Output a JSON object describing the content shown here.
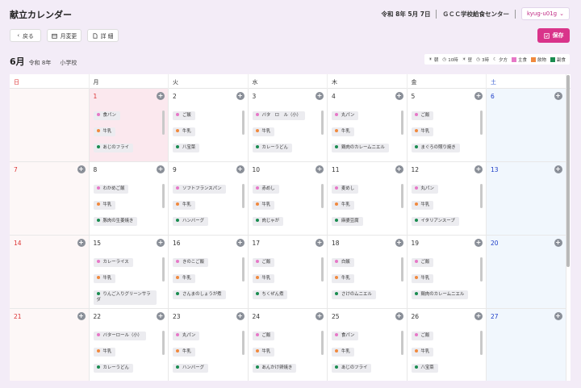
{
  "header": {
    "title": "献立カレンダー",
    "date": "令和 8年 5月 7日",
    "center": "ＧＣＣ学校給食センター",
    "user": "kyug-u01g"
  },
  "toolbar": {
    "back_label": "戻る",
    "month_change_label": "月変更",
    "detail_label": "詳 細",
    "save_label": "保存"
  },
  "month": {
    "title": "6月",
    "era": "令和 8年",
    "school": "小学校"
  },
  "legend": {
    "items": [
      {
        "label": "朝"
      },
      {
        "label": "10時"
      },
      {
        "label": "昼"
      },
      {
        "label": "3時"
      },
      {
        "label": "夕方"
      }
    ],
    "categories": [
      {
        "label": "主食",
        "color": "#e678c7"
      },
      {
        "label": "飲物",
        "color": "#f0893e"
      },
      {
        "label": "副食",
        "color": "#1a8c50"
      }
    ]
  },
  "weekdays": [
    "日",
    "月",
    "火",
    "水",
    "木",
    "金",
    "土"
  ],
  "weeks": [
    [
      {
        "day": "",
        "type": "sun",
        "items": []
      },
      {
        "day": "1",
        "type": "today",
        "items": [
          [
            "食パン",
            "main"
          ],
          [
            "牛乳",
            "milk"
          ],
          [
            "あじのフライ",
            "side"
          ]
        ]
      },
      {
        "day": "2",
        "type": "",
        "items": [
          [
            "ご飯",
            "main"
          ],
          [
            "牛乳",
            "milk"
          ],
          [
            "八宝菜",
            "side"
          ]
        ]
      },
      {
        "day": "3",
        "type": "",
        "items": [
          [
            "バタ　ロ　ル（小）",
            "main"
          ],
          [
            "牛乳",
            "milk"
          ],
          [
            "カレーうどん",
            "side"
          ]
        ]
      },
      {
        "day": "4",
        "type": "",
        "items": [
          [
            "丸パン",
            "main"
          ],
          [
            "牛乳",
            "milk"
          ],
          [
            "鶏肉のカレームニエル",
            "side"
          ]
        ]
      },
      {
        "day": "5",
        "type": "",
        "items": [
          [
            "ご飯",
            "main"
          ],
          [
            "牛乳",
            "milk"
          ],
          [
            "まぐろの照り焼き",
            "side"
          ]
        ]
      },
      {
        "day": "6",
        "type": "sat",
        "items": []
      }
    ],
    [
      {
        "day": "7",
        "type": "sun",
        "items": []
      },
      {
        "day": "8",
        "type": "",
        "items": [
          [
            "わかめご飯",
            "main"
          ],
          [
            "牛乳",
            "milk"
          ],
          [
            "豚肉の生姜焼き",
            "side"
          ]
        ]
      },
      {
        "day": "9",
        "type": "",
        "items": [
          [
            "ソフトフランスパン",
            "main"
          ],
          [
            "牛乳",
            "milk"
          ],
          [
            "ハンバーグ",
            "side"
          ]
        ]
      },
      {
        "day": "10",
        "type": "",
        "items": [
          [
            "赤めし",
            "main"
          ],
          [
            "牛乳",
            "milk"
          ],
          [
            "肉じゃが",
            "side"
          ]
        ]
      },
      {
        "day": "11",
        "type": "",
        "items": [
          [
            "麦めし",
            "main"
          ],
          [
            "牛乳",
            "milk"
          ],
          [
            "麻婆豆腐",
            "side"
          ]
        ]
      },
      {
        "day": "12",
        "type": "",
        "items": [
          [
            "丸パン",
            "main"
          ],
          [
            "牛乳",
            "milk"
          ],
          [
            "イタリアンスープ",
            "side"
          ]
        ]
      },
      {
        "day": "13",
        "type": "sat",
        "items": []
      }
    ],
    [
      {
        "day": "14",
        "type": "sun",
        "items": []
      },
      {
        "day": "15",
        "type": "",
        "items": [
          [
            "カレーライス",
            "main"
          ],
          [
            "牛乳",
            "milk"
          ],
          [
            "りんご入りグリーンサラダ",
            "side"
          ]
        ]
      },
      {
        "day": "16",
        "type": "",
        "items": [
          [
            "きのこご飯",
            "main"
          ],
          [
            "牛乳",
            "milk"
          ],
          [
            "さんまのしょうが煮",
            "side"
          ]
        ]
      },
      {
        "day": "17",
        "type": "",
        "items": [
          [
            "ご飯",
            "main"
          ],
          [
            "牛乳",
            "milk"
          ],
          [
            "ちくぜん煮",
            "side"
          ]
        ]
      },
      {
        "day": "18",
        "type": "",
        "items": [
          [
            "白飯",
            "main"
          ],
          [
            "牛乳",
            "milk"
          ],
          [
            "さけのムニエル",
            "side"
          ]
        ]
      },
      {
        "day": "19",
        "type": "",
        "items": [
          [
            "ご飯",
            "main"
          ],
          [
            "牛乳",
            "milk"
          ],
          [
            "鶏肉のカレームニエル",
            "side"
          ]
        ]
      },
      {
        "day": "20",
        "type": "sat",
        "items": []
      }
    ],
    [
      {
        "day": "21",
        "type": "sun",
        "items": []
      },
      {
        "day": "22",
        "type": "",
        "items": [
          [
            "バターロール（小）",
            "main"
          ],
          [
            "牛乳",
            "milk"
          ],
          [
            "カレーうどん",
            "side"
          ]
        ]
      },
      {
        "day": "23",
        "type": "",
        "items": [
          [
            "丸パン",
            "main"
          ],
          [
            "牛乳",
            "milk"
          ],
          [
            "ハンバーグ",
            "side"
          ]
        ]
      },
      {
        "day": "24",
        "type": "",
        "items": [
          [
            "ご飯",
            "main"
          ],
          [
            "牛乳",
            "milk"
          ],
          [
            "あんかけ卵焼き",
            "side"
          ]
        ]
      },
      {
        "day": "25",
        "type": "",
        "items": [
          [
            "食パン",
            "main"
          ],
          [
            "牛乳",
            "milk"
          ],
          [
            "あじのフライ",
            "side"
          ]
        ]
      },
      {
        "day": "26",
        "type": "",
        "items": [
          [
            "ご飯",
            "main"
          ],
          [
            "牛乳",
            "milk"
          ],
          [
            "八宝菜",
            "side"
          ]
        ]
      },
      {
        "day": "27",
        "type": "sat",
        "items": []
      }
    ]
  ]
}
